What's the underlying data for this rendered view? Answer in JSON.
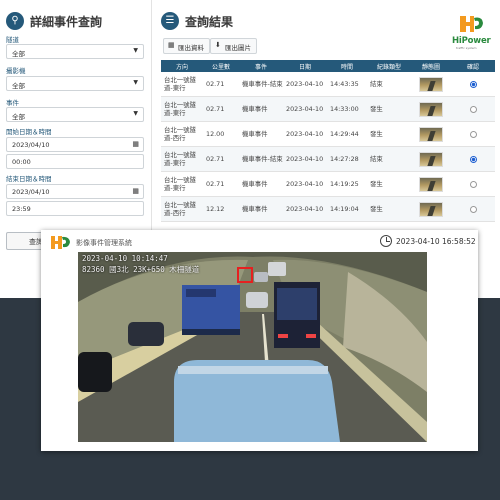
{
  "filter": {
    "title": "詳細事件查詢",
    "tunnel_label": "隧道",
    "tunnel_value": "全部",
    "camera_label": "攝影機",
    "camera_value": "全部",
    "event_label": "事件",
    "event_value": "全部",
    "start_label": "開始日期＆時間",
    "start_date": "2023/04/10",
    "start_time": "00:00",
    "end_label": "結束日期＆時間",
    "end_date": "2023/04/10",
    "end_time": "23:59",
    "query_button": "查詢"
  },
  "results": {
    "title": "查詢結果",
    "export_data_button": "匯出資料",
    "export_image_button": "匯出圖片",
    "columns": [
      "方向",
      "公里數",
      "事件",
      "日期",
      "時間",
      "紀錄類型",
      "靜態圖",
      "確認"
    ],
    "rows": [
      {
        "direction": "台北一號隧道-東行",
        "km": "02.71",
        "event": "機車事件-結束",
        "date": "2023-04-10",
        "time": "14:43:35",
        "type": "結束",
        "checked": true
      },
      {
        "direction": "台北一號隧道-東行",
        "km": "02.71",
        "event": "機車事件",
        "date": "2023-04-10",
        "time": "14:33:00",
        "type": "發生",
        "checked": false
      },
      {
        "direction": "台北一號隧道-西行",
        "km": "12.00",
        "event": "機車事件",
        "date": "2023-04-10",
        "time": "14:29:44",
        "type": "發生",
        "checked": false
      },
      {
        "direction": "台北一號隧道-東行",
        "km": "02.71",
        "event": "機車事件-結束",
        "date": "2023-04-10",
        "time": "14:27:28",
        "type": "結束",
        "checked": true
      },
      {
        "direction": "台北一號隧道-東行",
        "km": "02.71",
        "event": "機車事件",
        "date": "2023-04-10",
        "time": "14:19:25",
        "type": "發生",
        "checked": false
      },
      {
        "direction": "台北一號隧道-西行",
        "km": "12.12",
        "event": "機車事件",
        "date": "2023-04-10",
        "time": "14:19:04",
        "type": "發生",
        "checked": false
      }
    ]
  },
  "brand": {
    "name": "HiPower",
    "sub": "traffic system"
  },
  "viewer": {
    "title": "影像事件管理系統",
    "timestamp": "2023-04-10 16:58:52",
    "osd_line1": "2023-04-10  10:14:47",
    "osd_line2": "82360 國3北 23K+650 木柵隧道"
  },
  "colors": {
    "accent": "#25597a",
    "brand_green": "#2a8a3e",
    "brand_orange": "#f39a1f",
    "dark_bg": "#2e3842",
    "radio_selected": "#1d5fd1"
  }
}
